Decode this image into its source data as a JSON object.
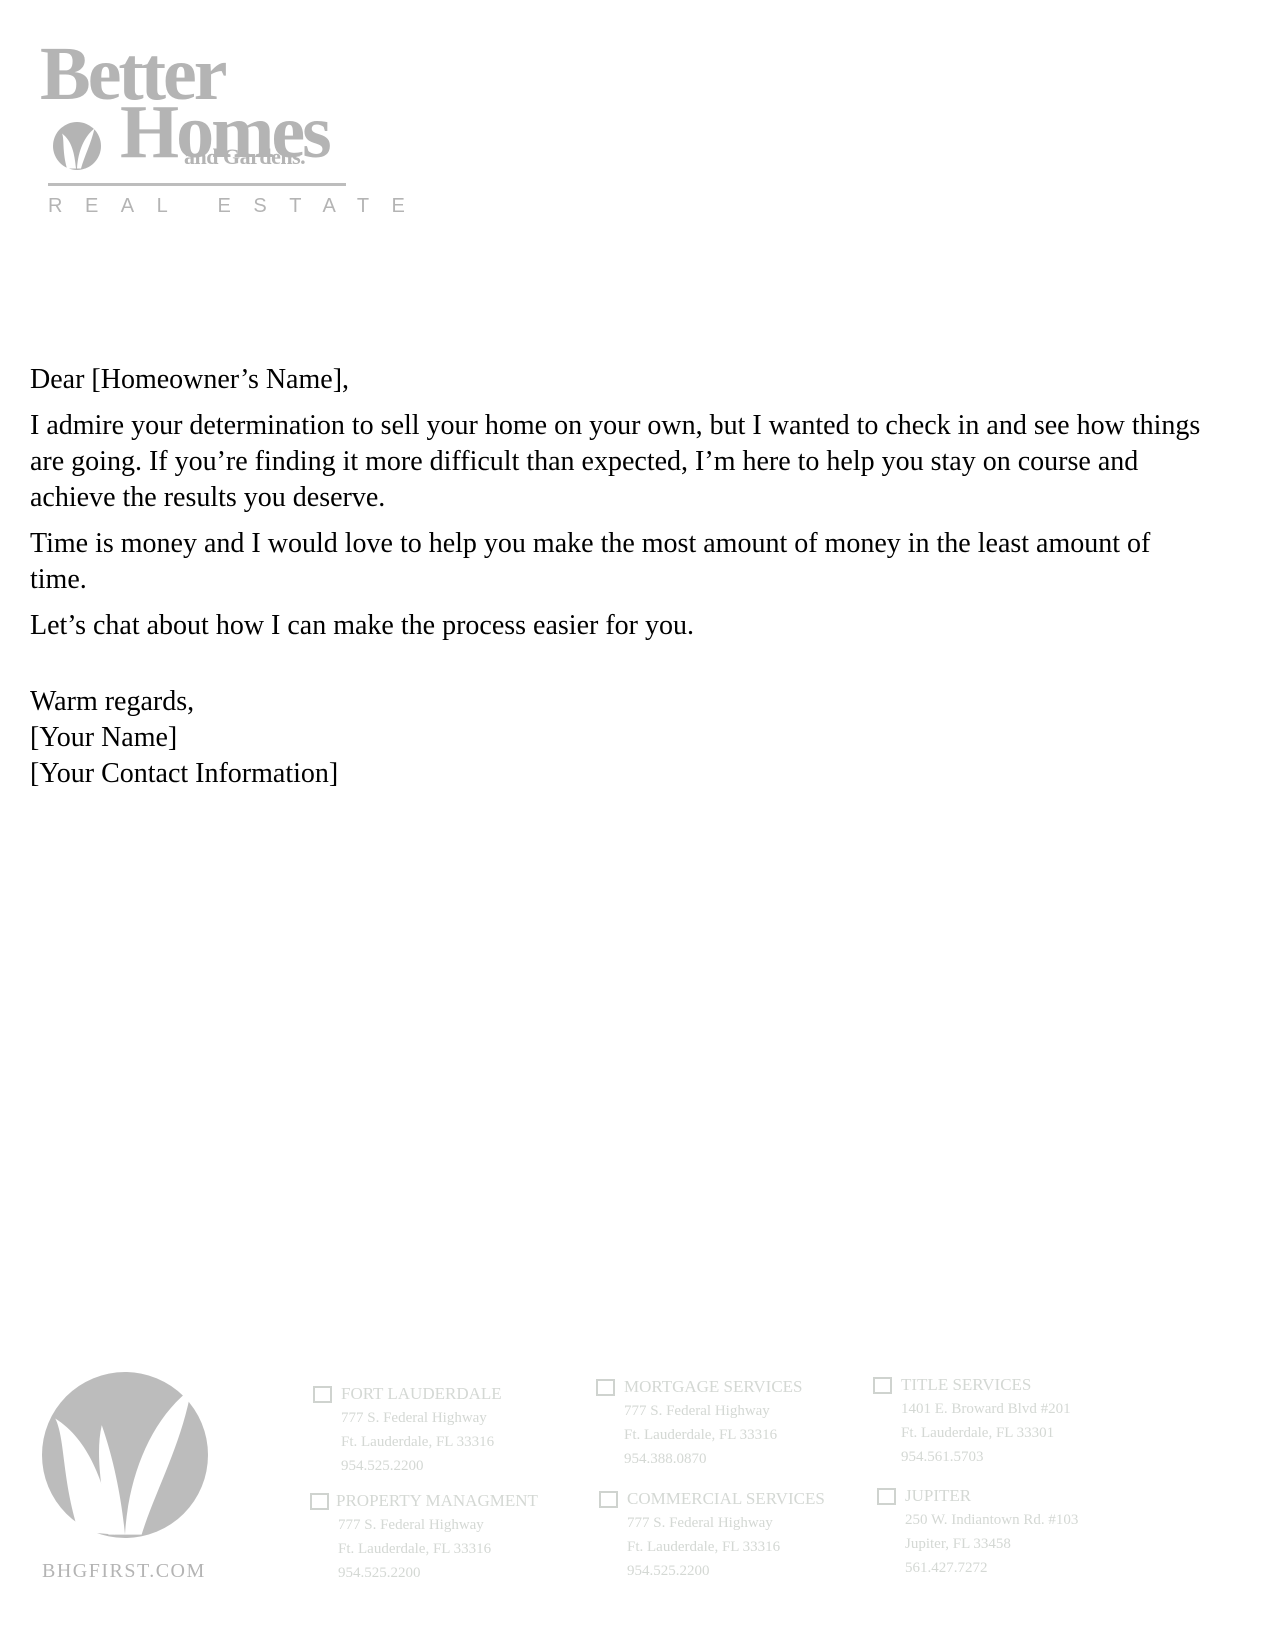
{
  "logo": {
    "line1": "Better",
    "line2": "Homes",
    "line3": "and Gardens.",
    "tagline": "REAL ESTATE"
  },
  "letter": {
    "salutation": "Dear [Homeowner’s Name],",
    "paragraphs": [
      "I admire your determination to sell your home on your own, but I wanted to check in and see how things are going. If you’re finding it more difficult than expected, I’m here to help you stay on course and achieve the results you deserve.",
      "Time is money and I would love to help you make the most amount of money in the least amount of time.",
      "Let’s chat about how I can make the process easier for you."
    ],
    "closing": "Warm regards,",
    "signature_name": "[Your Name]",
    "signature_contact": "[Your Contact Information]"
  },
  "footer": {
    "website": "BHGFIRST.COM",
    "offices": [
      {
        "name": "FORT LAUDERDALE",
        "address1": "777 S. Federal Highway",
        "address2": "Ft. Lauderdale, FL 33316",
        "phone": "954.525.2200"
      },
      {
        "name": "MORTGAGE SERVICES",
        "address1": "777 S. Federal Highway",
        "address2": "Ft. Lauderdale, FL 33316",
        "phone": "954.388.0870"
      },
      {
        "name": "TITLE SERVICES",
        "address1": "1401 E. Broward Blvd #201",
        "address2": "Ft. Lauderdale, FL 33301",
        "phone": "954.561.5703"
      },
      {
        "name": "PROPERTY MANAGMENT",
        "address1": "777 S. Federal Highway",
        "address2": "Ft. Lauderdale, FL 33316",
        "phone": "954.525.2200"
      },
      {
        "name": "COMMERCIAL SERVICES",
        "address1": "777 S. Federal Highway",
        "address2": "Ft. Lauderdale, FL 33316",
        "phone": "954.525.2200"
      },
      {
        "name": "JUPITER",
        "address1": "250 W. Indiantown Rd. #103",
        "address2": "Jupiter, FL 33458",
        "phone": "561.427.7272"
      }
    ]
  },
  "colors": {
    "logo_gray": "#b4b4b4",
    "footer_text": "#d4d8d4"
  },
  "icons": {
    "logo_leaf": "leaf-emblem-icon",
    "checkbox": "checkbox-icon"
  }
}
